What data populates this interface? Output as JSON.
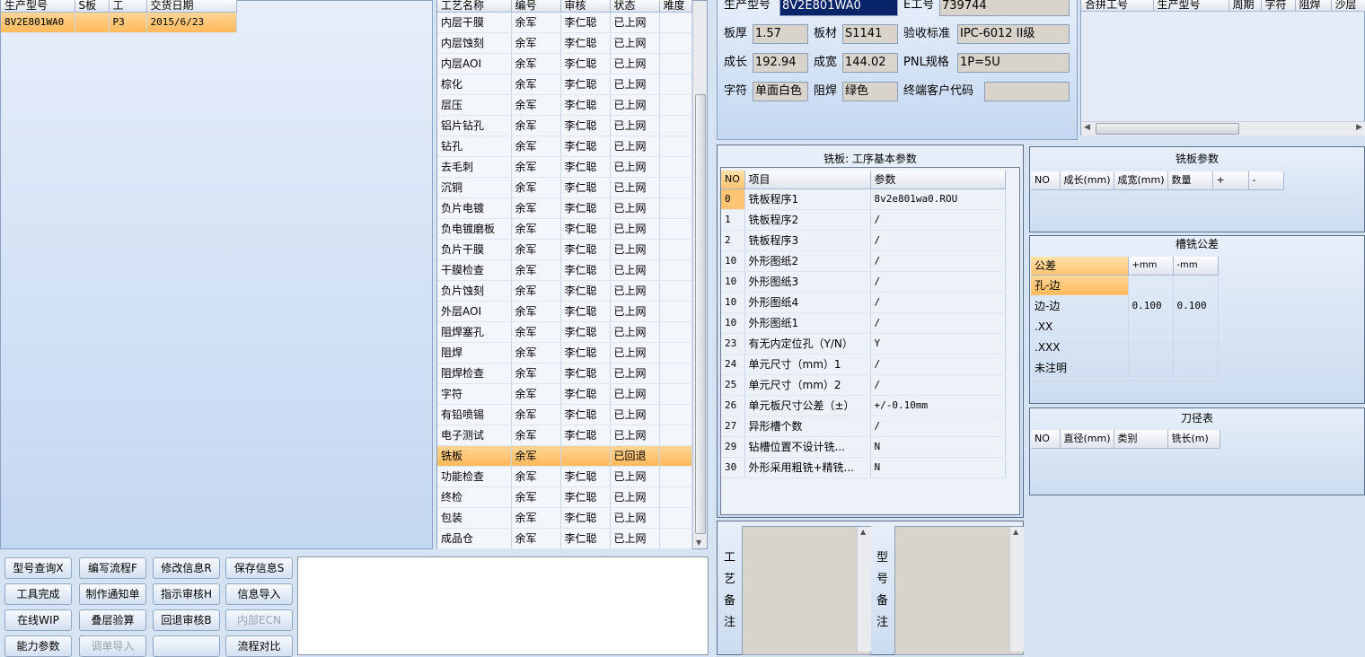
{
  "left_table": {
    "headers": [
      "生产型号",
      "S板",
      "工",
      "交货日期"
    ],
    "rows": [
      [
        "8V2E801WA0",
        "",
        "P3",
        "2015/6/23"
      ]
    ]
  },
  "process_table": {
    "headers": [
      "工艺名称",
      "编号",
      "审核",
      "状态",
      "难度"
    ],
    "rows": [
      [
        "内层干膜",
        "余军",
        "李仁聪",
        "已上网",
        ""
      ],
      [
        "内层蚀刻",
        "余军",
        "李仁聪",
        "已上网",
        ""
      ],
      [
        "内层AOI",
        "余军",
        "李仁聪",
        "已上网",
        ""
      ],
      [
        "棕化",
        "余军",
        "李仁聪",
        "已上网",
        ""
      ],
      [
        "层压",
        "余军",
        "李仁聪",
        "已上网",
        ""
      ],
      [
        "铝片钻孔",
        "余军",
        "李仁聪",
        "已上网",
        ""
      ],
      [
        "钻孔",
        "余军",
        "李仁聪",
        "已上网",
        ""
      ],
      [
        "去毛刺",
        "余军",
        "李仁聪",
        "已上网",
        ""
      ],
      [
        "沉铜",
        "余军",
        "李仁聪",
        "已上网",
        ""
      ],
      [
        "负片电镀",
        "余军",
        "李仁聪",
        "已上网",
        ""
      ],
      [
        "负电镀磨板",
        "余军",
        "李仁聪",
        "已上网",
        ""
      ],
      [
        "负片干膜",
        "余军",
        "李仁聪",
        "已上网",
        ""
      ],
      [
        "干膜检查",
        "余军",
        "李仁聪",
        "已上网",
        ""
      ],
      [
        "负片蚀刻",
        "余军",
        "李仁聪",
        "已上网",
        ""
      ],
      [
        "外层AOI",
        "余军",
        "李仁聪",
        "已上网",
        ""
      ],
      [
        "阻焊塞孔",
        "余军",
        "李仁聪",
        "已上网",
        ""
      ],
      [
        "阻焊",
        "余军",
        "李仁聪",
        "已上网",
        ""
      ],
      [
        "阻焊检查",
        "余军",
        "李仁聪",
        "已上网",
        ""
      ],
      [
        "字符",
        "余军",
        "李仁聪",
        "已上网",
        ""
      ],
      [
        "有铅喷锡",
        "余军",
        "李仁聪",
        "已上网",
        ""
      ],
      [
        "电子测试",
        "余军",
        "李仁聪",
        "已上网",
        ""
      ],
      [
        "铣板",
        "余军",
        "",
        "已回退",
        ""
      ],
      [
        "功能检查",
        "余军",
        "李仁聪",
        "已上网",
        ""
      ],
      [
        "终检",
        "余军",
        "李仁聪",
        "已上网",
        ""
      ],
      [
        "包装",
        "余军",
        "李仁聪",
        "已上网",
        ""
      ],
      [
        "成品仓",
        "余军",
        "李仁聪",
        "已上网",
        ""
      ]
    ],
    "selected_index": 21
  },
  "buttons": [
    [
      "型号查询X",
      "编写流程F",
      "修改信息R",
      "保存信息S"
    ],
    [
      "工具完成",
      "制作通知单",
      "指示审核H",
      "信息导入"
    ],
    [
      "在线WIP",
      "叠层验算",
      "回退审核B",
      "内部ECN"
    ],
    [
      "能力参数",
      "调单导入",
      "",
      "流程对比"
    ]
  ],
  "disabled_buttons": [
    "内部ECN",
    "调单导入"
  ],
  "info": {
    "model_label": "生产型号",
    "model_value": "8V2E801WA0",
    "e_label": "E工号",
    "e_value": "739744",
    "thick_label": "板厚",
    "thick_value": "1.57",
    "mat_label": "板材",
    "mat_value": "S1141",
    "std_label": "验收标准",
    "std_value": "IPC-6012 II级",
    "len_label": "成长",
    "len_value": "192.94",
    "wid_label": "成宽",
    "wid_value": "144.02",
    "pnl_label": "PNL规格",
    "pnl_value": "1P=5U",
    "char_label": "字符",
    "char_value": "单面白色",
    "mask_label": "阻焊",
    "mask_value": "绿色",
    "cust_label": "终端客户代码",
    "cust_value": ""
  },
  "merge_table": {
    "headers": [
      "合拼工号",
      "生产型号",
      "周期",
      "字符",
      "阻焊",
      "沙层"
    ]
  },
  "routing": {
    "title": "铣板: 工序基本参数",
    "headers": [
      "NO",
      "项目",
      "参数"
    ],
    "rows": [
      [
        "0",
        "铣板程序1",
        "8v2e801wa0.ROU"
      ],
      [
        "1",
        "铣板程序2",
        "/"
      ],
      [
        "2",
        "铣板程序3",
        "/"
      ],
      [
        "10",
        "外形图纸2",
        "/"
      ],
      [
        "10",
        "外形图纸3",
        "/"
      ],
      [
        "10",
        "外形图纸4",
        "/"
      ],
      [
        "10",
        "外形图纸1",
        "/"
      ],
      [
        "23",
        "有无内定位孔（Y/N）",
        "Y"
      ],
      [
        "24",
        "单元尺寸（mm）1",
        "/"
      ],
      [
        "25",
        "单元尺寸（mm）2",
        "/"
      ],
      [
        "26",
        "单元板尺寸公差（±）",
        "+/-0.10mm"
      ],
      [
        "27",
        "异形槽个数",
        "/"
      ],
      [
        "29",
        "钻槽位置不设计铣...",
        "N"
      ],
      [
        "30",
        "外形采用粗铣+精铣...",
        "N"
      ]
    ]
  },
  "mill_params": {
    "title": "铣板参数",
    "headers": [
      "NO",
      "成长(mm)",
      "成宽(mm)",
      "数量",
      "+",
      "-"
    ]
  },
  "slot_tol": {
    "title": "槽铣公差",
    "headers": [
      "公差",
      "+mm",
      "-mm"
    ],
    "rows": [
      [
        "孔-边",
        "",
        ""
      ],
      [
        "边-边",
        "0.100",
        "0.100"
      ],
      [
        ".XX",
        "",
        ""
      ],
      [
        ".XXX",
        "",
        ""
      ],
      [
        "未注明",
        "",
        ""
      ]
    ]
  },
  "tool_table": {
    "title": "刀径表",
    "headers": [
      "NO",
      "直径(mm)",
      "类别",
      "铣长(m)"
    ]
  },
  "notes": {
    "process_label": "工艺备注",
    "model_label": "型号备注"
  },
  "colors": {
    "selection": "#ffc474",
    "background": "#d6e3f3"
  }
}
